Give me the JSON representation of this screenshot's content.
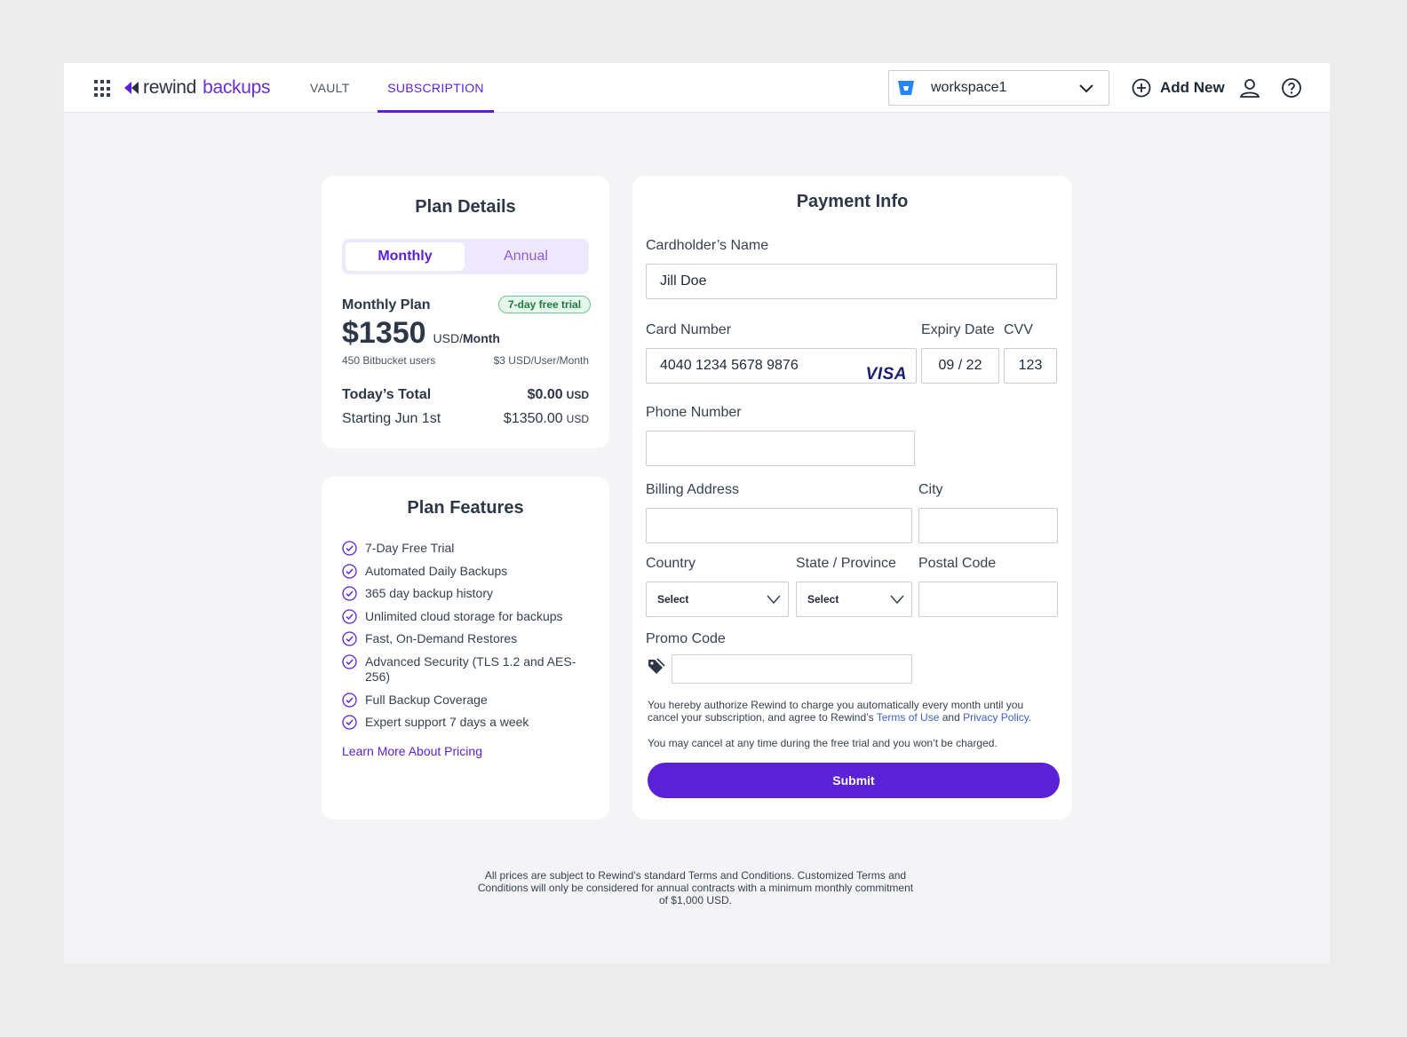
{
  "header": {
    "brand_part1": "rewind",
    "brand_part2": "backups",
    "nav": [
      {
        "label": "VAULT"
      },
      {
        "label": "SUBSCRIPTION"
      }
    ],
    "workspace": "workspace1",
    "add_new_label": "Add New"
  },
  "plan_details": {
    "title": "Plan Details",
    "toggle": {
      "monthly": "Monthly",
      "annual": "Annual",
      "selected": "Monthly"
    },
    "plan_name": "Monthly Plan",
    "trial_badge": "7-day free trial",
    "price": "$1350",
    "price_unit_currency": "USD/",
    "price_unit_period": "Month",
    "users": "450 Bitbucket users",
    "per_user": "$3 USD/User/Month",
    "todays_total_label": "Today’s Total",
    "todays_total_value": "$0.00",
    "starting_label": "Starting Jun 1st",
    "starting_value": "$1350.00",
    "currency": "USD"
  },
  "plan_features": {
    "title": "Plan Features",
    "items": [
      "7-Day Free Trial",
      "Automated Daily Backups",
      "365 day backup history",
      "Unlimited cloud storage for backups",
      "Fast, On-Demand Restores",
      "Advanced Security (TLS 1.2 and AES-256)",
      "Full Backup Coverage",
      "Expert support 7 days a week"
    ],
    "learn_more": "Learn More About Pricing"
  },
  "payment": {
    "title": "Payment Info",
    "cardholder_label": "Cardholder’s Name",
    "cardholder_value": "Jill Doe",
    "card_number_label": "Card Number",
    "card_number_value": "4040 1234 5678 9876",
    "card_brand": "VISA",
    "expiry_label": "Expiry Date",
    "expiry_value": "09 / 22",
    "cvv_label": "CVV",
    "cvv_value": "123",
    "phone_label": "Phone Number",
    "phone_value": "",
    "billing_label": "Billing Address",
    "billing_value": "",
    "city_label": "City",
    "city_value": "",
    "country_label": "Country",
    "country_value": "Select",
    "state_label": "State / Province",
    "state_value": "Select",
    "postal_label": "Postal Code",
    "postal_value": "",
    "promo_label": "Promo Code",
    "promo_value": "",
    "legal_pre": "You hereby authorize Rewind to charge you automatically every month until you cancel your subscription, and agree to Rewind’s ",
    "terms_link": "Terms of Use",
    "legal_and": " and ",
    "privacy_link": "Privacy Policy",
    "legal_end": ".",
    "cancel_note": "You may cancel at any time during the free trial and you won’t be charged.",
    "submit_label": "Submit"
  },
  "footer_note": "All prices are subject to Rewind’s standard Terms and Conditions. Customized Terms and Conditions will only be considered for annual contracts with a minimum monthly commitment of $1,000 USD.",
  "colors": {
    "accent": "#5b21d6",
    "badge_green": "#1d7a3f",
    "link_blue": "#3b5fd6"
  }
}
